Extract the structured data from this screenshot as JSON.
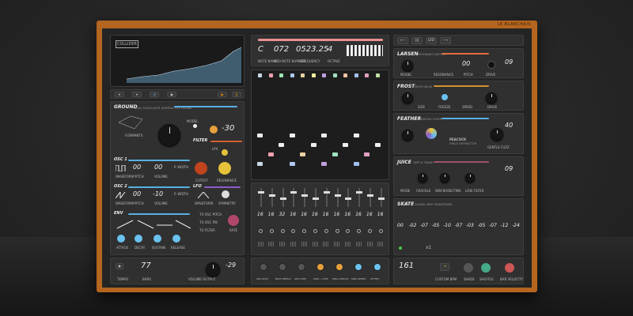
{
  "brand": "LE BLANCHAIS",
  "logo": "COLLIDER",
  "header": {
    "note": "C",
    "midi": "072",
    "freq": "0523.25",
    "octave": "4",
    "note_label": "NOTE NAME",
    "midi_label": "MIDI NOTE NUMBER",
    "freq_label": "FREQUENCY",
    "octave_label": "OCTAVE",
    "nav_buttons": [
      "⟵",
      "|||",
      "LFO",
      "⟶"
    ]
  },
  "ground": {
    "title": "GROUND",
    "sub": "DUAL OSCILLATOR SUBTRACTIVE ENGINE",
    "model_label": "MODEL",
    "voices": "-30",
    "formats_label": "FORMANTS",
    "filter_title": "FILTER",
    "filter_type": "LP4",
    "cutoff_label": "CUTOFF",
    "resonance_label": "RESONANCE",
    "osc1_title": "OSC 1",
    "osc1_val": "00",
    "osc1_val2": "00",
    "osc2_title": "OSC 2",
    "osc2_val": "00",
    "osc2_val2": "-10",
    "waveform_label": "WAVEFORM",
    "pitch_label": "PITCH",
    "volume_label": "VOLUME",
    "fine_label": "FINE",
    "pwidth_label": "P. WIDTH",
    "lfo_title": "LFO",
    "lfo_wave_label": "WAVEFORM",
    "lfo_sym_label": "SYMMETRY",
    "env_title": "ENV",
    "attack_label": "ATTACK",
    "decay_label": "DECAY",
    "sustain_label": "SUSTAIN",
    "release_label": "RELEASE",
    "routes": [
      "TO OSC PITCH",
      "TO OSC PW",
      "TO FILTER"
    ],
    "rate_label": "RATE"
  },
  "bottom_left": {
    "tempo": "77",
    "tempo_label": "TEMPO",
    "vol": "-29",
    "vol_label": "VOLUME OUTPUT",
    "bars_label": "BARS"
  },
  "bottom_mid": [
    "ADD MOD",
    "BEAT REPEAT",
    "ADD STEP",
    "RING • STEP",
    "RING LENGTH",
    "RING SPEED",
    "OFFSET"
  ],
  "mixer_values": [
    "16",
    "16",
    "32",
    "16",
    "16",
    "16",
    "16",
    "16",
    "16",
    "16",
    "16",
    "16"
  ],
  "mixer_colors": [
    "#c7d7e6",
    "#f0a0b0",
    "#9be6b0",
    "#b0c8f0",
    "#e8d0a0",
    "#f0f0a0",
    "#c0a0e0",
    "#a0e0c0",
    "#f0c0a0",
    "#a0c0f0",
    "#e0a0c0",
    "#c0e0a0"
  ],
  "larsen": {
    "title": "LARSEN",
    "sub": "RESONANT SHIFTER",
    "val": "00",
    "val2": "09",
    "labels": [
      "MODEL",
      "RESONANCE",
      "PITCH",
      "DRIVE"
    ]
  },
  "frost": {
    "title": "FROST",
    "sub": "MULTI DELAY",
    "labels": [
      "SIZE",
      "FREEZE",
      "SPEED",
      "DRIVE"
    ]
  },
  "feather": {
    "title": "FEATHER",
    "sub": "DIGITAL FILTER",
    "val": "40",
    "labels": [
      "MODEL",
      "CUTOFF",
      "RESONANCE"
    ],
    "peacock": "PEACOCK",
    "peacock_sub": "SPACE DIFFRACTOR",
    "fx_label": "GENTLE FUZZ"
  },
  "juice": {
    "title": "JUICE",
    "sub": "TAPE & TRADE",
    "val": "09",
    "labels": [
      "MODE",
      "CRACKLE",
      "WIN NOISE/TIME",
      "LOW FILTER"
    ]
  },
  "skate": {
    "title": "SKATE",
    "sub": "GLOBAL MIDI TRANSPOSER",
    "values": [
      "00",
      "-02",
      "-07",
      "-05",
      "-10",
      "-07",
      "-03",
      "-05",
      "-07",
      "-12",
      "-24"
    ],
    "bar": "x1"
  },
  "bottom_right": {
    "val": "161",
    "labels": [
      "CUSTOM BPM",
      "SHADE",
      "SHUFFLE",
      "BAR VELOCITY"
    ]
  }
}
